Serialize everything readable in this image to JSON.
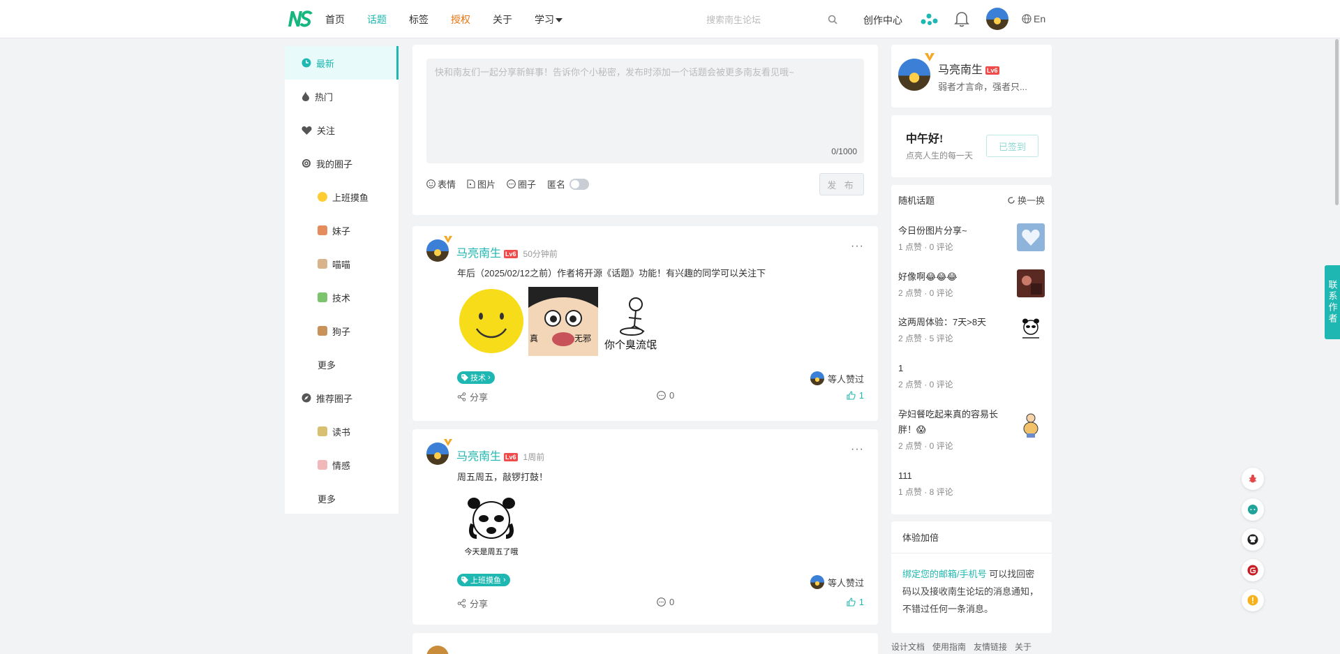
{
  "header": {
    "nav": [
      "首页",
      "话题",
      "标签",
      "授权",
      "关于",
      "学习"
    ],
    "search_placeholder": "搜索南生论坛",
    "create_center": "创作中心",
    "lang": "En"
  },
  "sidebar": {
    "items": [
      {
        "label": "最新",
        "icon": "clock-icon"
      },
      {
        "label": "热门",
        "icon": "flame-icon"
      },
      {
        "label": "关注",
        "icon": "heart-icon"
      },
      {
        "label": "我的圈子",
        "icon": "circle-icon"
      },
      {
        "label": "上班摸鱼",
        "icon": "smile-emoji-icon"
      },
      {
        "label": "妹子",
        "icon": "girl-emoji-icon"
      },
      {
        "label": "喵喵",
        "icon": "cat-emoji-icon"
      },
      {
        "label": "技术",
        "icon": "tech-emoji-icon"
      },
      {
        "label": "狗子",
        "icon": "dog-emoji-icon"
      },
      {
        "label": "更多"
      },
      {
        "label": "推荐圈子",
        "icon": "compass-icon"
      },
      {
        "label": "读书",
        "icon": "book-emoji-icon"
      },
      {
        "label": "情感",
        "icon": "love-emoji-icon"
      },
      {
        "label": "更多"
      }
    ]
  },
  "composer": {
    "placeholder": "快和南友们一起分享新鲜事！告诉你个小秘密，发布时添加一个话题会被更多南友看见哦~",
    "count": "0/1000",
    "tools": [
      "表情",
      "图片",
      "圈子",
      "匿名"
    ],
    "publish": "发 布"
  },
  "posts": [
    {
      "author": "马亮南生",
      "level": "Lv6",
      "time": "50分钟前",
      "content": "年后（2025/02/12之前）作者将开源《话题》功能！有兴趣的同学可以关注下",
      "image_captions": [
        "真",
        "无邪",
        "你个臭流氓"
      ],
      "tag": "技术",
      "likers": "等人赞过",
      "share": "分享",
      "comments": "0",
      "likes": "1"
    },
    {
      "author": "马亮南生",
      "level": "Lv6",
      "time": "1周前",
      "content": "周五周五，敲锣打鼓！",
      "image_captions": [
        "今天是周五了哦"
      ],
      "tag": "上班摸鱼",
      "likers": "等人赞过",
      "share": "分享",
      "comments": "0",
      "likes": "1"
    }
  ],
  "profile": {
    "name": "马亮南生",
    "level": "Lv6",
    "motto": "弱者才言命，强者只..."
  },
  "greeting": {
    "title": "中午好!",
    "subtitle": "点亮人生的每一天",
    "button": "已签到"
  },
  "random_topics": {
    "title": "随机话题",
    "refresh": "换一换",
    "items": [
      {
        "title": "今日份图片分享~",
        "meta": "1 点赞 · 0 评论"
      },
      {
        "title": "好像啊😂😂😂",
        "meta": "2 点赞 · 0 评论"
      },
      {
        "title": "这两周体验：7天>8天",
        "meta": "2 点赞 · 5 评论"
      },
      {
        "title": "1",
        "meta": "2 点赞 · 0 评论"
      },
      {
        "title": "孕妇餐吃起来真的容易长胖！😱",
        "meta": "2 点赞 · 0 评论"
      },
      {
        "title": "111",
        "meta": "1 点赞 · 8 评论"
      }
    ]
  },
  "bonus": {
    "title": "体验加倍",
    "link": "绑定您的邮箱/手机号",
    "text": " 可以找回密码以及接收南生论坛的消息通知，不错过任何一条消息。"
  },
  "footer_links": [
    "设计文档",
    "使用指南",
    "友情链接",
    "关于"
  ],
  "contact": "联系作者",
  "colors": {
    "accent": "#1fb7b1",
    "auth": "#e8740f",
    "level": "#ef4b4b"
  }
}
